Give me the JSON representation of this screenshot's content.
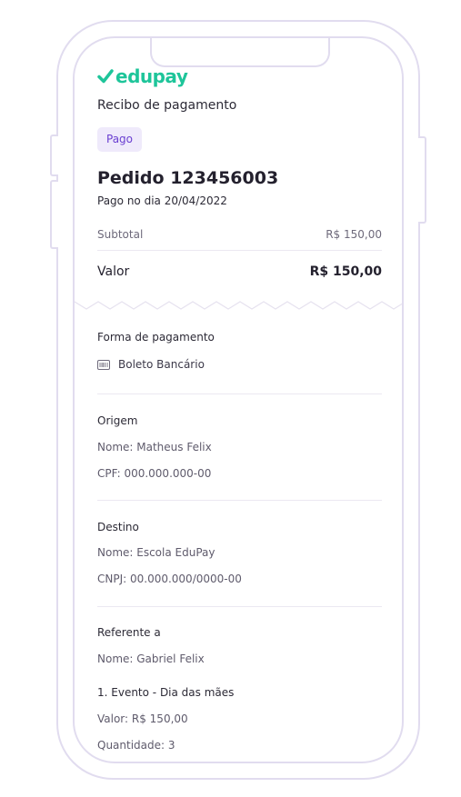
{
  "brand": {
    "name": "edupay",
    "color": "#1ec59a"
  },
  "receipt": {
    "title": "Recibo de pagamento",
    "status_badge": "Pago",
    "order_title": "Pedido 123456003",
    "paid_date": "Pago no dia 20/04/2022",
    "subtotal_label": "Subtotal",
    "subtotal_value": "R$ 150,00",
    "total_label": "Valor",
    "total_value": "R$ 150,00"
  },
  "payment": {
    "title": "Forma de pagamento",
    "method_icon": "barcode-icon",
    "method": "Boleto Bancário"
  },
  "origin": {
    "title": "Origem",
    "name": "Nome: Matheus Felix",
    "cpf": "CPF: 000.000.000-00"
  },
  "destination": {
    "title": "Destino",
    "name": "Nome: Escola EduPay",
    "cnpj": "CNPJ: 00.000.000/0000-00"
  },
  "reference": {
    "title": "Referente a",
    "name": "Nome: Gabriel Felix",
    "item_title": "1. Evento - Dia das mães",
    "item_value": "Valor: R$ 150,00",
    "item_quantity": "Quantidade: 3"
  },
  "colors": {
    "frame": "#e1dcef",
    "badge_bg": "#efeafb",
    "badge_text": "#6a3fd1"
  }
}
